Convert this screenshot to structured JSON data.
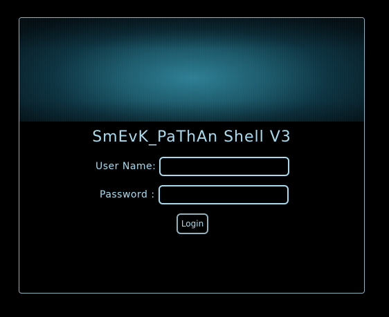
{
  "header": {
    "title": "SmEvK_PaThAn Shell V3"
  },
  "login_form": {
    "username_label": "User Name:",
    "username_value": "",
    "password_label": "Password :",
    "password_value": "",
    "submit_label": "Login"
  },
  "colors": {
    "background": "#000000",
    "text_accent": "#a6dcee",
    "border": "#8fb3bf",
    "banner_center": "#2f7f95",
    "banner_edge": "#061820"
  }
}
